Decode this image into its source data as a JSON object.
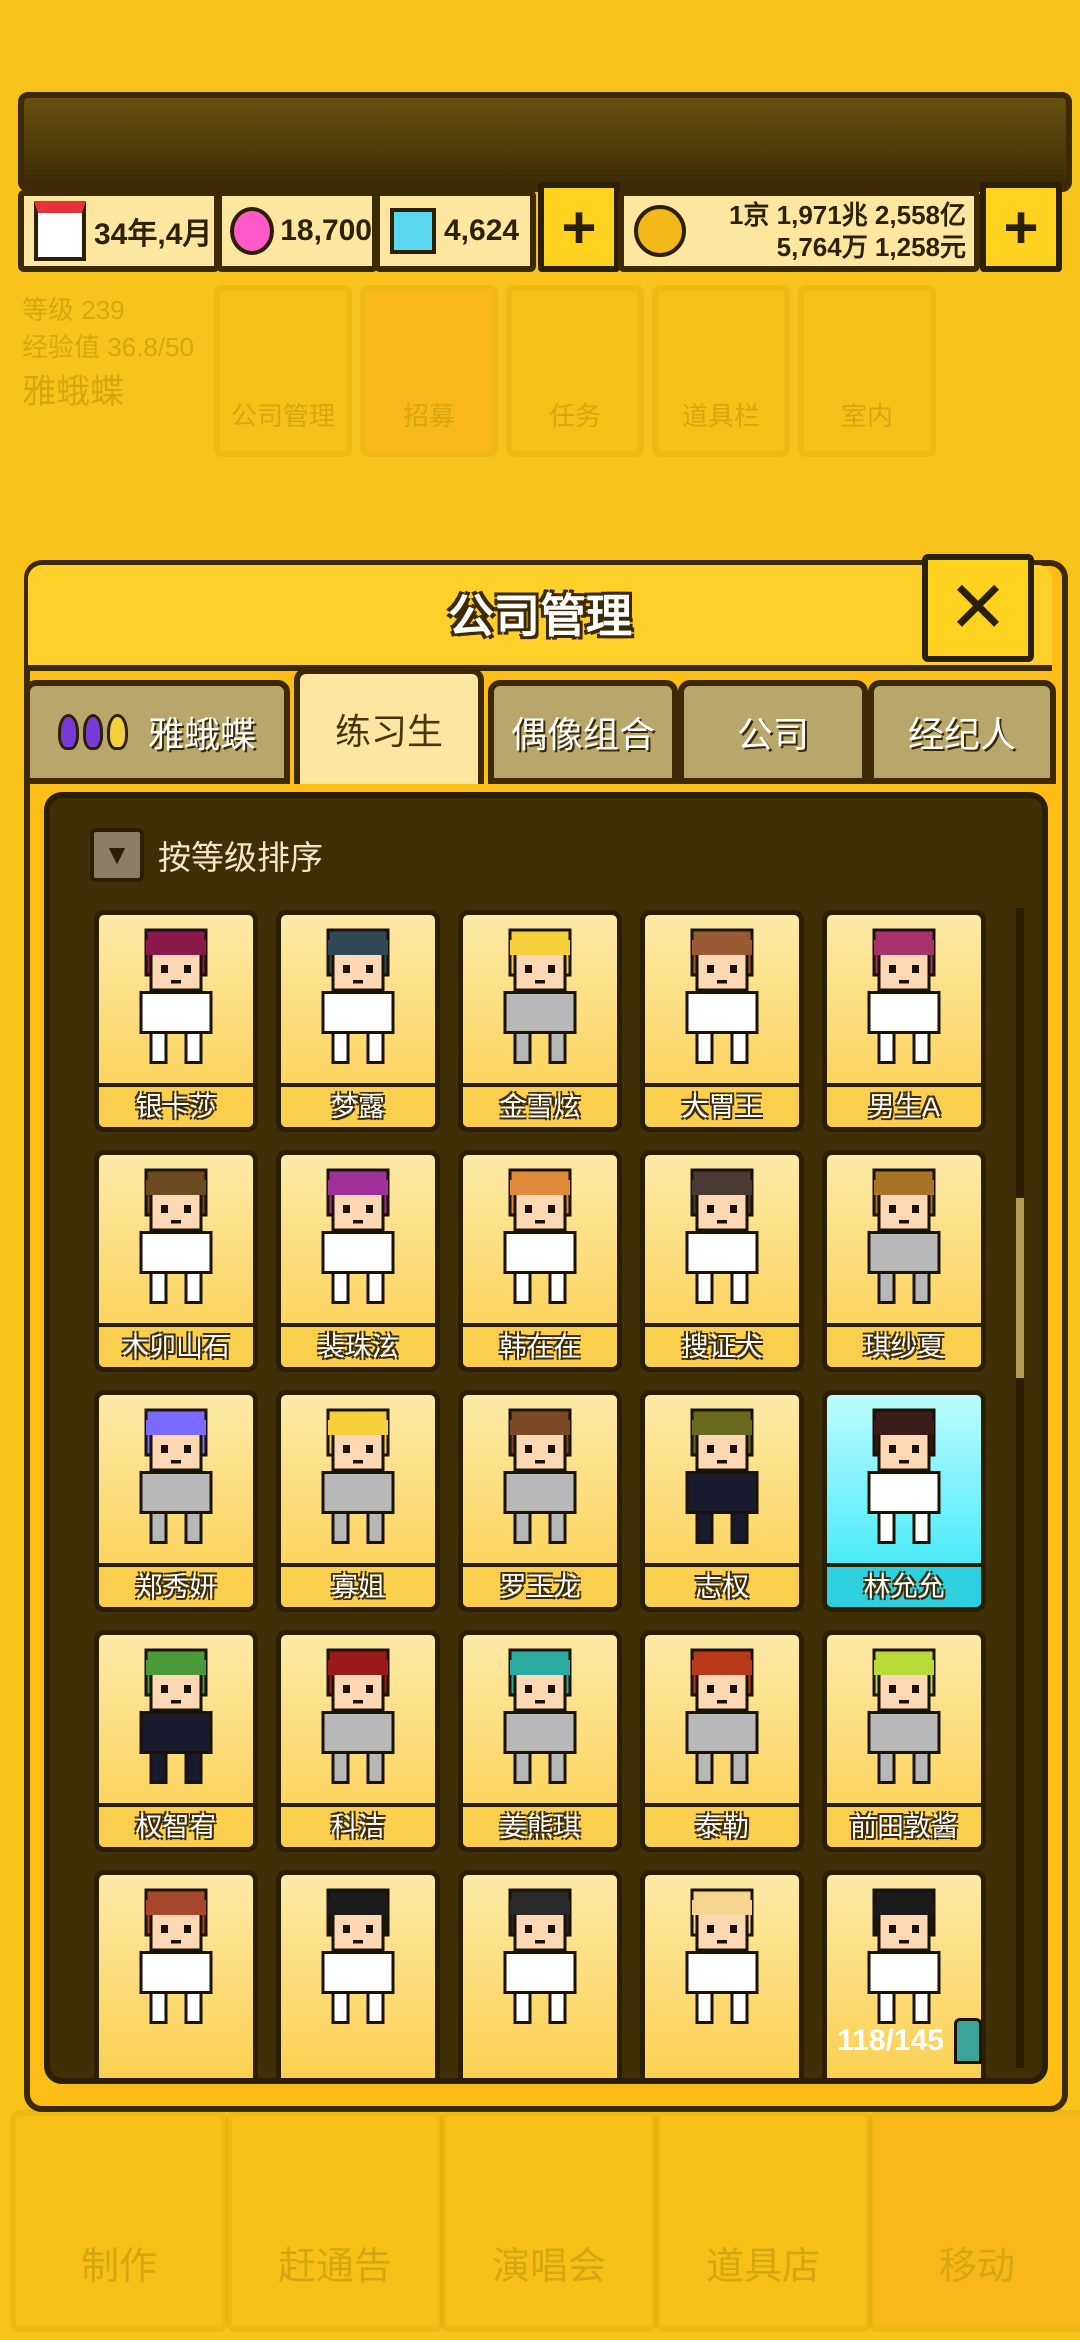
{
  "header": {
    "date": "34年,4月",
    "pink_gems": "18,700",
    "blue_gems": "4,624",
    "money_line1": "1京 1,971兆 2,558亿",
    "money_line2": "5,764万 1,258元",
    "plus": "+"
  },
  "background": {
    "level_label": "等级",
    "level_value": "239",
    "exp": "经验值 36.8/50",
    "company_name": "雅蛾蝶",
    "menu": [
      "公司管理",
      "招募",
      "任务",
      "道具栏",
      "室内"
    ],
    "bottom_nav": [
      "制作",
      "赶通告",
      "演唱会",
      "道具店",
      "移动"
    ]
  },
  "modal": {
    "title": "公司管理",
    "close": "✕",
    "tabs": [
      "雅蛾蝶",
      "练习生",
      "偶像组合",
      "公司",
      "经纪人"
    ],
    "active_tab": 1,
    "sort_label": "按等级排序",
    "count": "118/145"
  },
  "trainees": [
    {
      "name": "银卡莎",
      "hair": "#8a1a4a",
      "shirt": "#ffffff"
    },
    {
      "name": "梦露",
      "hair": "#2f4a56",
      "shirt": "#ffffff"
    },
    {
      "name": "金雪炫",
      "hair": "#f5d03a",
      "shirt": "#b8b8b8"
    },
    {
      "name": "大胃王",
      "hair": "#9a5a34",
      "shirt": "#ffffff"
    },
    {
      "name": "男生A",
      "hair": "#a8326a",
      "shirt": "#ffffff"
    },
    {
      "name": "木卯山石",
      "hair": "#6a4a1e",
      "shirt": "#ffffff"
    },
    {
      "name": "裴珠泫",
      "hair": "#a0309a",
      "shirt": "#ffffff"
    },
    {
      "name": "韩在在",
      "hair": "#e08a3a",
      "shirt": "#ffffff"
    },
    {
      "name": "搜证犬",
      "hair": "#4a3a34",
      "shirt": "#ffffff"
    },
    {
      "name": "琪纱夏",
      "hair": "#a8742a",
      "shirt": "#b8b8b8"
    },
    {
      "name": "郑秀妍",
      "hair": "#7a6aff",
      "shirt": "#b8b8b8"
    },
    {
      "name": "寡姐",
      "hair": "#f5d03a",
      "shirt": "#b8b8b8"
    },
    {
      "name": "罗玉龙",
      "hair": "#7a4a24",
      "shirt": "#b8b8b8"
    },
    {
      "name": "志权",
      "hair": "#6a6a1e",
      "shirt": "#1a1a2e"
    },
    {
      "name": "林允允",
      "hair": "#3a1a1a",
      "shirt": "#ffffff"
    },
    {
      "name": "权智宥",
      "hair": "#4a9a3a",
      "shirt": "#1a1a2e"
    },
    {
      "name": "科洁",
      "hair": "#9a1a1a",
      "shirt": "#b8b8b8"
    },
    {
      "name": "姜熊琪",
      "hair": "#2aaaa0",
      "shirt": "#b8b8b8"
    },
    {
      "name": "泰勒",
      "hair": "#b83a1a",
      "shirt": "#b8b8b8"
    },
    {
      "name": "前田敦酱",
      "hair": "#bada3a",
      "shirt": "#b8b8b8"
    },
    {
      "name": "",
      "hair": "#a8482a",
      "shirt": "#ffffff"
    },
    {
      "name": "",
      "hair": "#1a1a1a",
      "shirt": "#ffffff"
    },
    {
      "name": "",
      "hair": "#2a2a2a",
      "shirt": "#ffffff"
    },
    {
      "name": "",
      "hair": "#f5d590",
      "shirt": "#ffffff"
    },
    {
      "name": "",
      "hair": "#1a1a1a",
      "shirt": "#ffffff"
    }
  ],
  "selected_index": 14
}
